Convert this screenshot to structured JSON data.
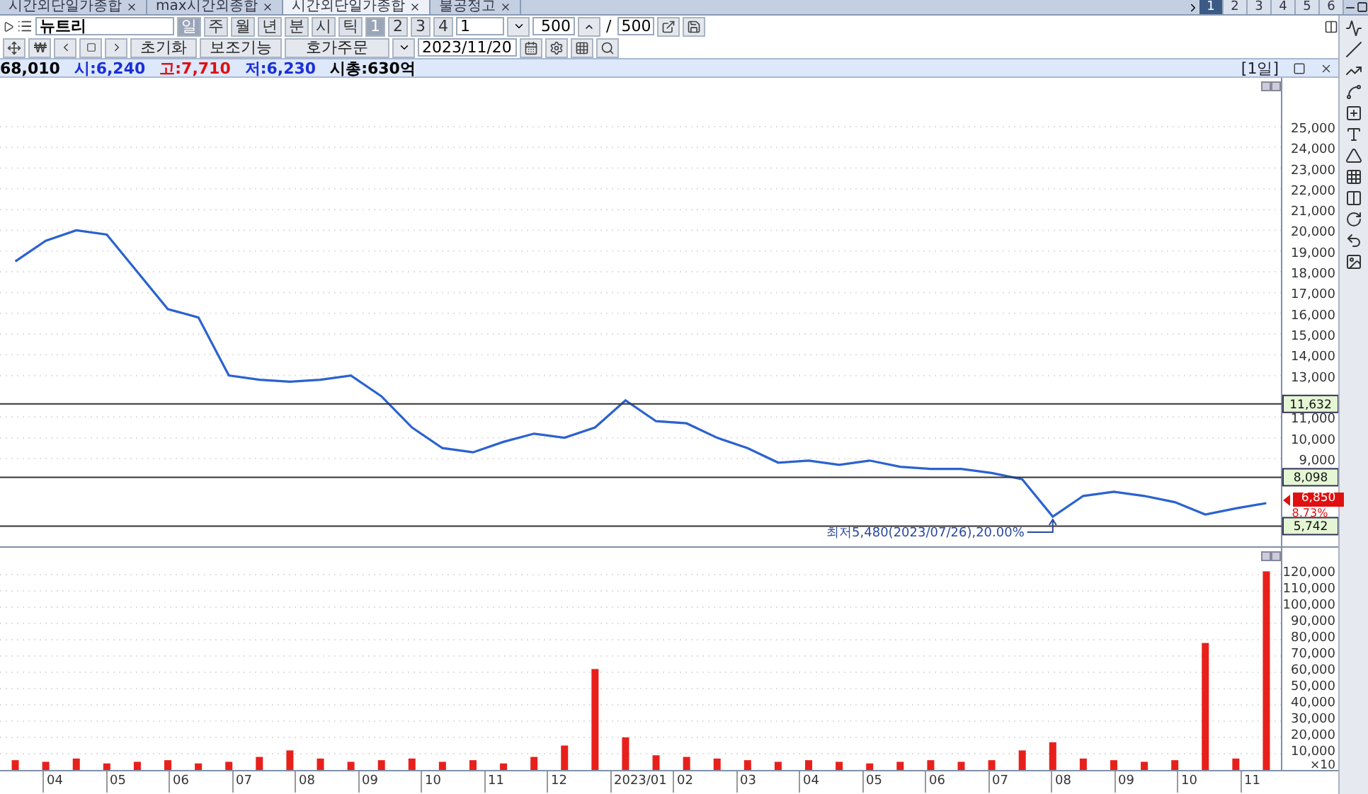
{
  "tabs": [
    {
      "label": "시간외단일가종합",
      "selected": false
    },
    {
      "label": "max시간외종합",
      "selected": false
    },
    {
      "label": "시간외단일가종합",
      "selected": true
    },
    {
      "label": "불공정고",
      "selected": false
    }
  ],
  "pages": [
    {
      "label": "1",
      "selected": true
    },
    {
      "label": "2",
      "selected": false
    },
    {
      "label": "3",
      "selected": false
    },
    {
      "label": "4",
      "selected": false
    },
    {
      "label": "5",
      "selected": false
    },
    {
      "label": "6",
      "selected": false
    }
  ],
  "symbol": {
    "name": "뉴트리"
  },
  "periods": [
    {
      "label": "일",
      "selected": true
    },
    {
      "label": "주",
      "selected": false
    },
    {
      "label": "월",
      "selected": false
    },
    {
      "label": "년",
      "selected": false
    },
    {
      "label": "분",
      "selected": false
    },
    {
      "label": "시",
      "selected": false
    },
    {
      "label": "틱",
      "selected": false
    }
  ],
  "slots": [
    {
      "label": "1",
      "selected": true
    },
    {
      "label": "2",
      "selected": false
    },
    {
      "label": "3",
      "selected": false
    },
    {
      "label": "4",
      "selected": false
    }
  ],
  "interval": {
    "value": "1"
  },
  "count": {
    "value": "500",
    "separator": "/",
    "total": "500"
  },
  "buttons": [
    "초기화",
    "보조기능"
  ],
  "order_button": {
    "label": "호가주문"
  },
  "date": {
    "value": "2023/11/20"
  },
  "quote": [
    {
      "text": "68,010",
      "color": "#000000"
    },
    {
      "text": "시:6,240",
      "color": "#1a2fd8"
    },
    {
      "text": "고:7,710",
      "color": "#e01010"
    },
    {
      "text": "저:6,230",
      "color": "#1a2fd8"
    },
    {
      "text": "시총:630억",
      "color": "#000000"
    }
  ],
  "period_label": "[1일]",
  "price_chart": {
    "chart_data": {
      "type": "line",
      "grid": true,
      "ylim": [
        4700,
        27350
      ],
      "series": [
        {
          "color": "#2a62d0",
          "values": [
            18500,
            19500,
            20000,
            19800,
            18000,
            16200,
            15800,
            13000,
            12800,
            12700,
            12800,
            13000,
            12000,
            10500,
            9500,
            9300,
            9800,
            10200,
            10000,
            10500,
            11800,
            10800,
            10700,
            10000,
            9500,
            8800,
            8900,
            8700,
            8900,
            8600,
            8500,
            8500,
            8300,
            8000,
            6200,
            7200,
            7400,
            7200,
            6900,
            6300,
            6600,
            6850
          ]
        }
      ],
      "yticks": [
        {
          "value": 25000,
          "label": "25,000"
        },
        {
          "value": 24000,
          "label": "24,000"
        },
        {
          "value": 23000,
          "label": "23,000"
        },
        {
          "value": 22000,
          "label": "22,000"
        },
        {
          "value": 21000,
          "label": "21,000"
        },
        {
          "value": 20000,
          "label": "20,000"
        },
        {
          "value": 19000,
          "label": "19,000"
        },
        {
          "value": 18000,
          "label": "18,000"
        },
        {
          "value": 17000,
          "label": "17,000"
        },
        {
          "value": 16000,
          "label": "16,000"
        },
        {
          "value": 15000,
          "label": "15,000"
        },
        {
          "value": 14000,
          "label": "14,000"
        },
        {
          "value": 13000,
          "label": "13,000"
        },
        {
          "value": 11000,
          "label": "11,000"
        },
        {
          "value": 10000,
          "label": "10,000"
        },
        {
          "value": 9000,
          "label": "9,000"
        }
      ],
      "ref_lines": [
        {
          "axis": "y",
          "value": 11632,
          "label": "11,632"
        },
        {
          "axis": "y",
          "value": 8098,
          "label": "8,098"
        },
        {
          "axis": "y",
          "value": 5742,
          "label": "5,742"
        }
      ]
    },
    "last_price": {
      "label": "6,850",
      "change": "8.73%"
    },
    "low_note": {
      "label": "최저5,480(2023/07/26),20.00%"
    }
  },
  "volume_chart": {
    "chart_data": {
      "type": "bar",
      "grid": true,
      "ylim": [
        0,
        136500
      ],
      "ylabel": "×10",
      "series": [
        {
          "color": "#e8201c",
          "values": [
            6000,
            5000,
            7000,
            4000,
            5000,
            6000,
            4000,
            5000,
            8000,
            12000,
            7000,
            5000,
            6000,
            7000,
            5000,
            6000,
            4000,
            8000,
            15000,
            62000,
            20000,
            9000,
            8000,
            7000,
            6000,
            5000,
            6000,
            5000,
            4000,
            5000,
            6000,
            5000,
            6000,
            12000,
            17000,
            7000,
            6000,
            5000,
            6000,
            78000,
            7000,
            122000
          ]
        }
      ],
      "yticks": [
        {
          "value": 120000,
          "label": "120,000"
        },
        {
          "value": 110000,
          "label": "110,000"
        },
        {
          "value": 100000,
          "label": "100,000"
        },
        {
          "value": 90000,
          "label": "90,000"
        },
        {
          "value": 80000,
          "label": "80,000"
        },
        {
          "value": 70000,
          "label": "70,000"
        },
        {
          "value": 60000,
          "label": "60,000"
        },
        {
          "value": 50000,
          "label": "50,000"
        },
        {
          "value": 40000,
          "label": "40,000"
        },
        {
          "value": 30000,
          "label": "30,000"
        },
        {
          "value": 20000,
          "label": "20,000"
        },
        {
          "value": 10000,
          "label": "10,000"
        }
      ]
    }
  },
  "x_axis": [
    "04",
    "05",
    "06",
    "07",
    "08",
    "09",
    "10",
    "11",
    "12",
    "2023/01",
    "02",
    "03",
    "04",
    "05",
    "06",
    "07",
    "08",
    "09",
    "10",
    "11"
  ]
}
